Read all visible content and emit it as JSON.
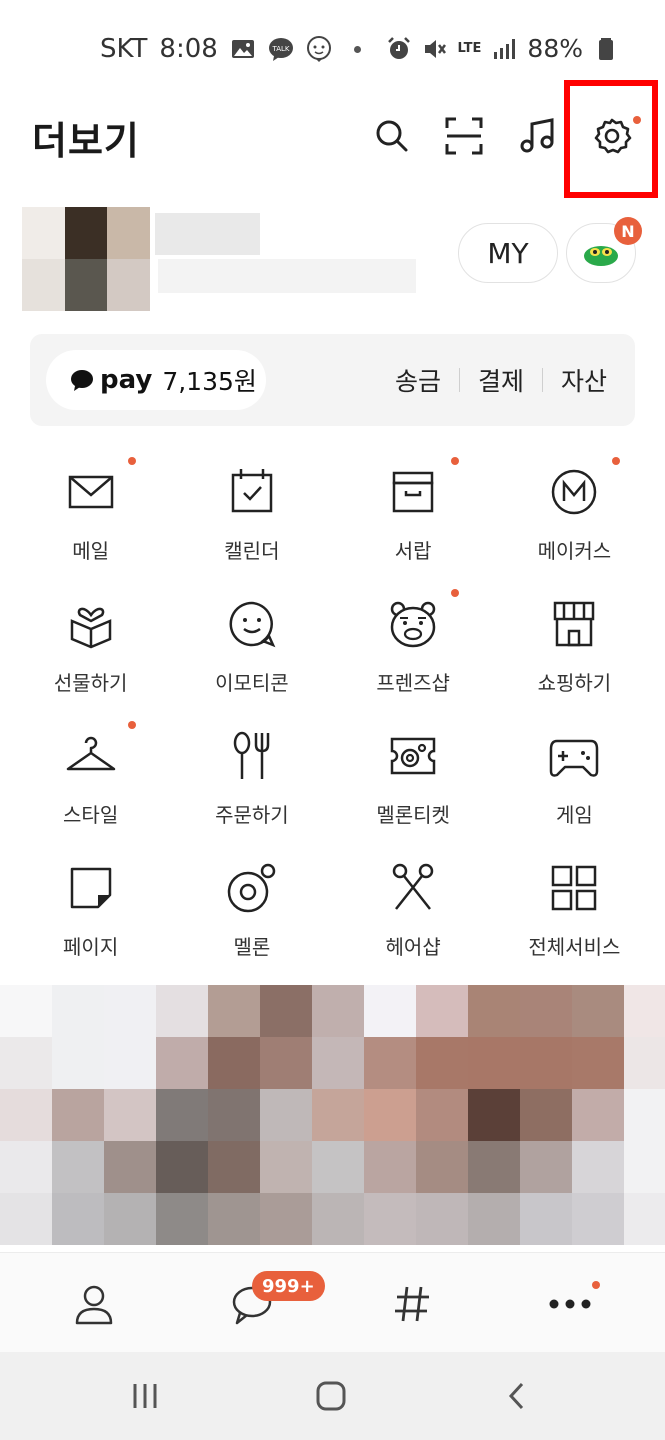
{
  "status_bar": {
    "carrier": "SKT",
    "time": "8:08",
    "network": "LTE",
    "battery": "88%",
    "talk_icon_text": "TALK"
  },
  "header": {
    "title": "더보기",
    "actions": [
      "search-icon",
      "scan-icon",
      "music-icon",
      "settings-icon"
    ]
  },
  "profile": {
    "my_label": "MY",
    "character_badge": "N"
  },
  "pay": {
    "logo": "pay",
    "amount": "7,135원",
    "links": [
      "송금",
      "결제",
      "자산"
    ]
  },
  "services": [
    {
      "label": "메일",
      "icon": "mail-icon",
      "new": true
    },
    {
      "label": "캘린더",
      "icon": "calendar-icon",
      "new": false
    },
    {
      "label": "서랍",
      "icon": "drawer-icon",
      "new": true
    },
    {
      "label": "메이커스",
      "icon": "makers-icon",
      "new": true
    },
    {
      "label": "선물하기",
      "icon": "gift-icon",
      "new": false
    },
    {
      "label": "이모티콘",
      "icon": "emoticon-icon",
      "new": false
    },
    {
      "label": "프렌즈샵",
      "icon": "friends-shop-icon",
      "new": true
    },
    {
      "label": "쇼핑하기",
      "icon": "shopping-icon",
      "new": false
    },
    {
      "label": "스타일",
      "icon": "hanger-icon",
      "new": true
    },
    {
      "label": "주문하기",
      "icon": "order-icon",
      "new": false
    },
    {
      "label": "멜론티켓",
      "icon": "ticket-icon",
      "new": false
    },
    {
      "label": "게임",
      "icon": "game-icon",
      "new": false
    },
    {
      "label": "페이지",
      "icon": "page-icon",
      "new": false
    },
    {
      "label": "멜론",
      "icon": "melon-icon",
      "new": false
    },
    {
      "label": "헤어샵",
      "icon": "scissors-icon",
      "new": false
    },
    {
      "label": "전체서비스",
      "icon": "all-services-icon",
      "new": false
    }
  ],
  "bottom_nav": {
    "items": [
      "friends-icon",
      "chats-icon",
      "hashtag-icon",
      "more-icon"
    ],
    "chat_badge": "999+"
  },
  "colors": {
    "accent_dot": "#e8603c",
    "highlight_box": "#ff0000",
    "pay_bg": "#f4f4f4"
  }
}
